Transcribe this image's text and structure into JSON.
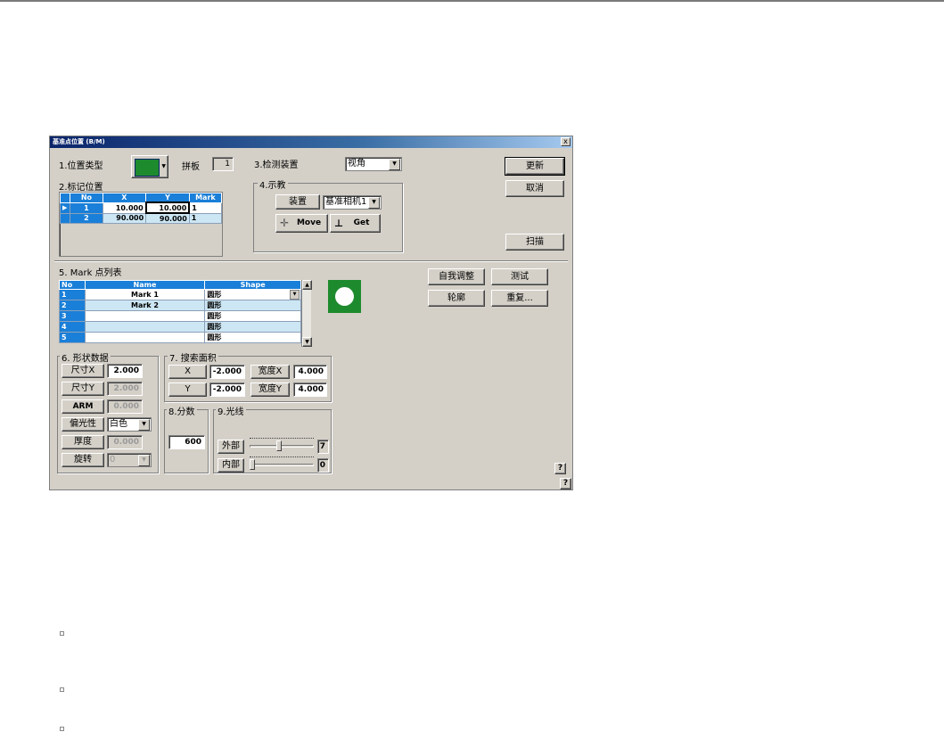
{
  "window": {
    "title": "基准点位置 (B/M)",
    "close_label": "x"
  },
  "section1": {
    "title": "1.位置类型",
    "panel_label": "拼板",
    "panel_value": "1"
  },
  "section2": {
    "title": "2.标记位置",
    "columns": [
      "No",
      "X",
      "Y",
      "Mark"
    ],
    "rows": [
      {
        "no": "1",
        "x": "10.000",
        "y": "10.000",
        "mark": "1"
      },
      {
        "no": "2",
        "x": "90.000",
        "y": "90.000",
        "mark": "1"
      }
    ]
  },
  "section3": {
    "title": "3.检测装置",
    "device_value": "视角"
  },
  "section4": {
    "title": "4.示教",
    "device_label": "装置",
    "camera_value": "基准相机1",
    "move_label": "Move",
    "get_label": "Get"
  },
  "buttons": {
    "update": "更新",
    "cancel": "取消",
    "scan": "扫描",
    "self_adjust": "自我调整",
    "test": "测试",
    "outline": "轮廓",
    "repeat": "重复..."
  },
  "section5": {
    "title": "5. Mark 点列表",
    "columns": [
      "No",
      "Name",
      "Shape"
    ],
    "rows": [
      {
        "no": "1",
        "name": "Mark 1",
        "shape": "圆形"
      },
      {
        "no": "2",
        "name": "Mark 2",
        "shape": "圆形"
      },
      {
        "no": "3",
        "name": "",
        "shape": "圆形"
      },
      {
        "no": "4",
        "name": "",
        "shape": "圆形"
      },
      {
        "no": "5",
        "name": "",
        "shape": "圆形"
      }
    ]
  },
  "section6": {
    "title": "6. 形状数据",
    "size_x_label": "尺寸X",
    "size_x": "2.000",
    "size_y_label": "尺寸Y",
    "size_y": "2.000",
    "arm_label": "ARM",
    "arm": "0.000",
    "polarity_label": "偏光性",
    "polarity": "白色",
    "thickness_label": "厚度",
    "thickness": "0.000",
    "rotation_label": "旋转",
    "rotation": "0"
  },
  "section7": {
    "title": "7. 搜索面积",
    "x_label": "X",
    "x": "-2.000",
    "width_x_label": "宽度X",
    "width_x": "4.000",
    "y_label": "Y",
    "y": "-2.000",
    "width_y_label": "宽度Y",
    "width_y": "4.000"
  },
  "section8": {
    "title": "8.分数",
    "score": "600"
  },
  "section9": {
    "title": "9.光线",
    "outer_label": "外部",
    "outer_value": "7",
    "outer_level": 0.45,
    "inner_label": "内部",
    "inner_value": "0",
    "inner_level": 0.0
  },
  "help_label": "?",
  "colors": {
    "title_bar": "#0a246a",
    "table_header": "#1a7fd8",
    "mark_preview": "#1e8a2e",
    "face": "#d4d0c8"
  }
}
